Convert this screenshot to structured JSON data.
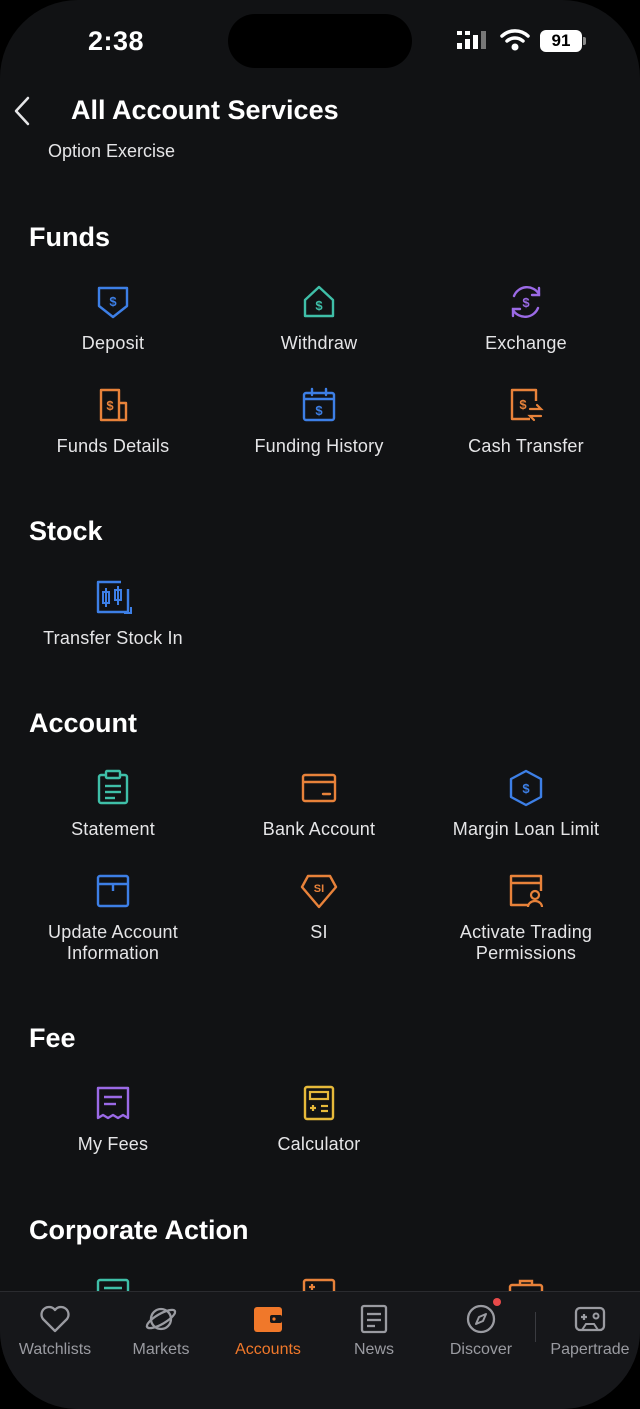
{
  "status_bar": {
    "time": "2:38",
    "battery": "91"
  },
  "header": {
    "title": "All Account Services"
  },
  "cut_item": "Option Exercise",
  "sections": {
    "funds": {
      "title": "Funds",
      "items": [
        "Deposit",
        "Withdraw",
        "Exchange",
        "Funds Details",
        "Funding History",
        "Cash Transfer"
      ]
    },
    "stock": {
      "title": "Stock",
      "items": [
        "Transfer Stock In"
      ]
    },
    "account": {
      "title": "Account",
      "items": [
        "Statement",
        "Bank Account",
        "Margin Loan Limit",
        "Update Account Information",
        "SI",
        "Activate Trading Permissions"
      ]
    },
    "fee": {
      "title": "Fee",
      "items": [
        "My Fees",
        "Calculator"
      ]
    },
    "corporate": {
      "title": "Corporate Action"
    }
  },
  "tabs": [
    "Watchlists",
    "Markets",
    "Accounts",
    "News",
    "Discover",
    "Papertrade"
  ],
  "active_tab": "Accounts",
  "colors": {
    "background": "#111214",
    "accent": "#f0782a",
    "blue": "#3d7fe6",
    "teal": "#3fbfa8",
    "purple": "#9b6ae6",
    "orange": "#e8823a",
    "yellow": "#e6b93a"
  }
}
